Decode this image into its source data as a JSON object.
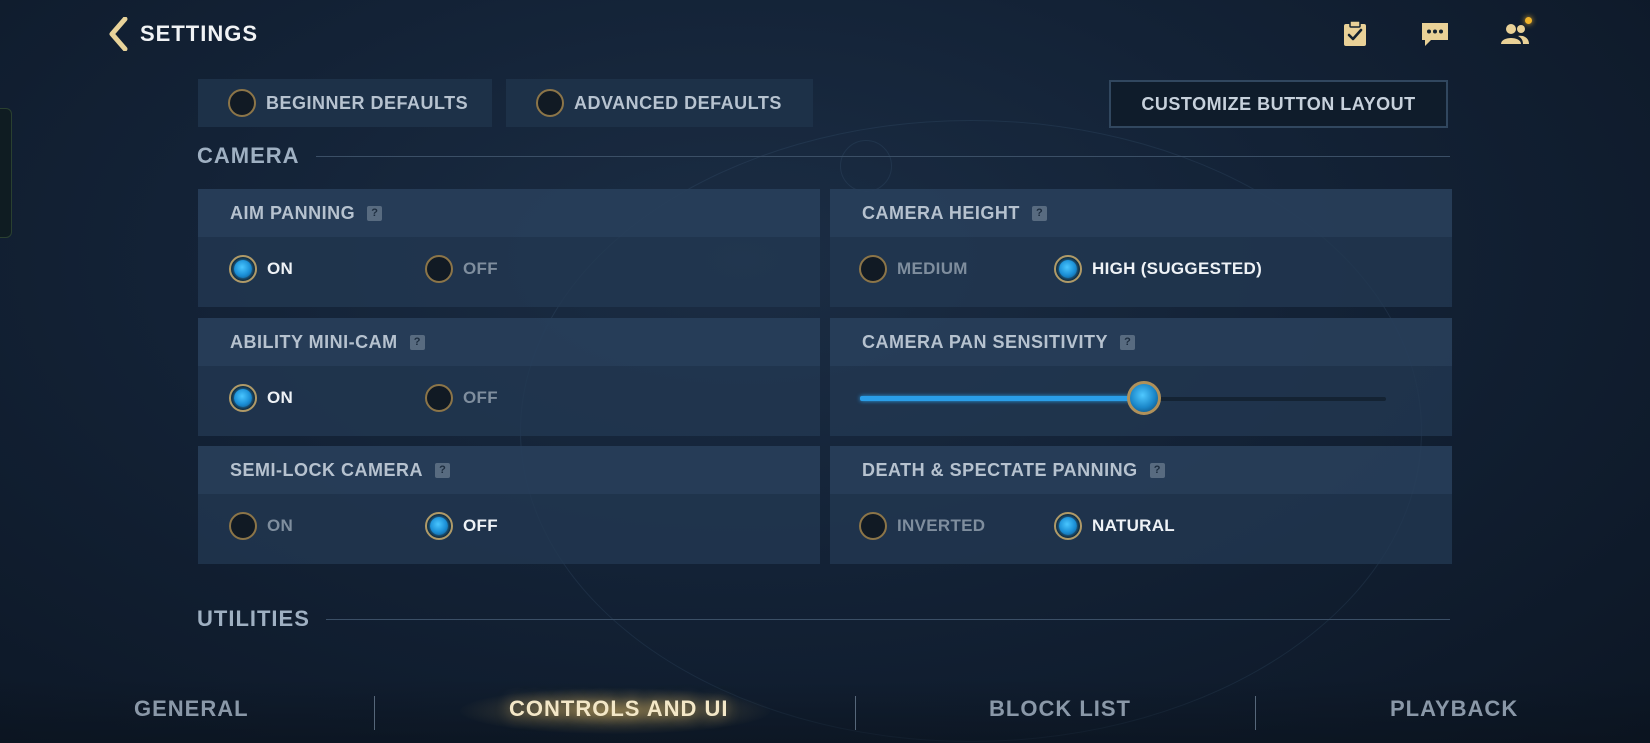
{
  "header": {
    "title": "SETTINGS",
    "icons": [
      "checklist-icon",
      "chat-icon",
      "friends-icon"
    ]
  },
  "presets": {
    "beginner": "BEGINNER DEFAULTS",
    "advanced": "ADVANCED DEFAULTS",
    "customize": "CUSTOMIZE BUTTON LAYOUT"
  },
  "sections": {
    "camera": "CAMERA",
    "utilities": "UTILITIES"
  },
  "settings": {
    "aim_panning": {
      "title": "AIM PANNING",
      "options": [
        "ON",
        "OFF"
      ],
      "selected": "ON"
    },
    "camera_height": {
      "title": "CAMERA HEIGHT",
      "options": [
        "MEDIUM",
        "HIGH (SUGGESTED)"
      ],
      "selected": "HIGH (SUGGESTED)"
    },
    "ability_minicam": {
      "title": "ABILITY MINI-CAM",
      "options": [
        "ON",
        "OFF"
      ],
      "selected": "ON"
    },
    "camera_pan_sensitivity": {
      "title": "CAMERA PAN SENSITIVITY",
      "value_fraction": 0.54
    },
    "semi_lock_camera": {
      "title": "SEMI-LOCK CAMERA",
      "options": [
        "ON",
        "OFF"
      ],
      "selected": "OFF"
    },
    "death_spectate_panning": {
      "title": "DEATH & SPECTATE PANNING",
      "options": [
        "INVERTED",
        "NATURAL"
      ],
      "selected": "NATURAL"
    }
  },
  "help_glyph": "?",
  "nav": {
    "tabs": [
      "GENERAL",
      "CONTROLS AND UI",
      "BLOCK LIST",
      "PLAYBACK"
    ],
    "active": "CONTROLS AND UI"
  },
  "colors": {
    "accent_blue": "#2a9ee8",
    "radio_border": "#b99a5f",
    "notification": "#f0b32a"
  }
}
